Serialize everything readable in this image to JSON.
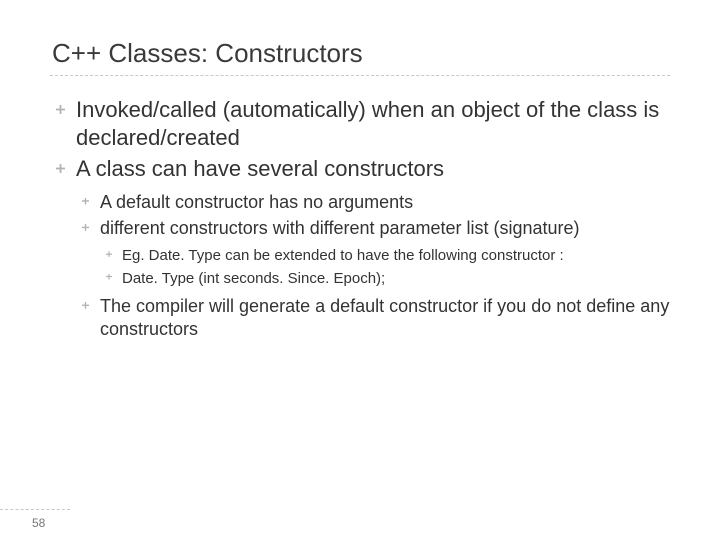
{
  "slide": {
    "title": "C++ Classes: Constructors",
    "pageNumber": "58",
    "bullets_lvl1": [
      "Invoked/called (automatically) when an object of the class is declared/created",
      "A class can have several constructors"
    ],
    "bullets_lvl2": [
      "A default constructor has no arguments",
      "different constructors with different parameter list (signature)",
      "The compiler will generate a default constructor if you do not define any constructors"
    ],
    "bullets_lvl3": [
      "Eg. Date. Type can be extended to have the following constructor :",
      "Date. Type (int seconds. Since. Epoch);"
    ]
  }
}
